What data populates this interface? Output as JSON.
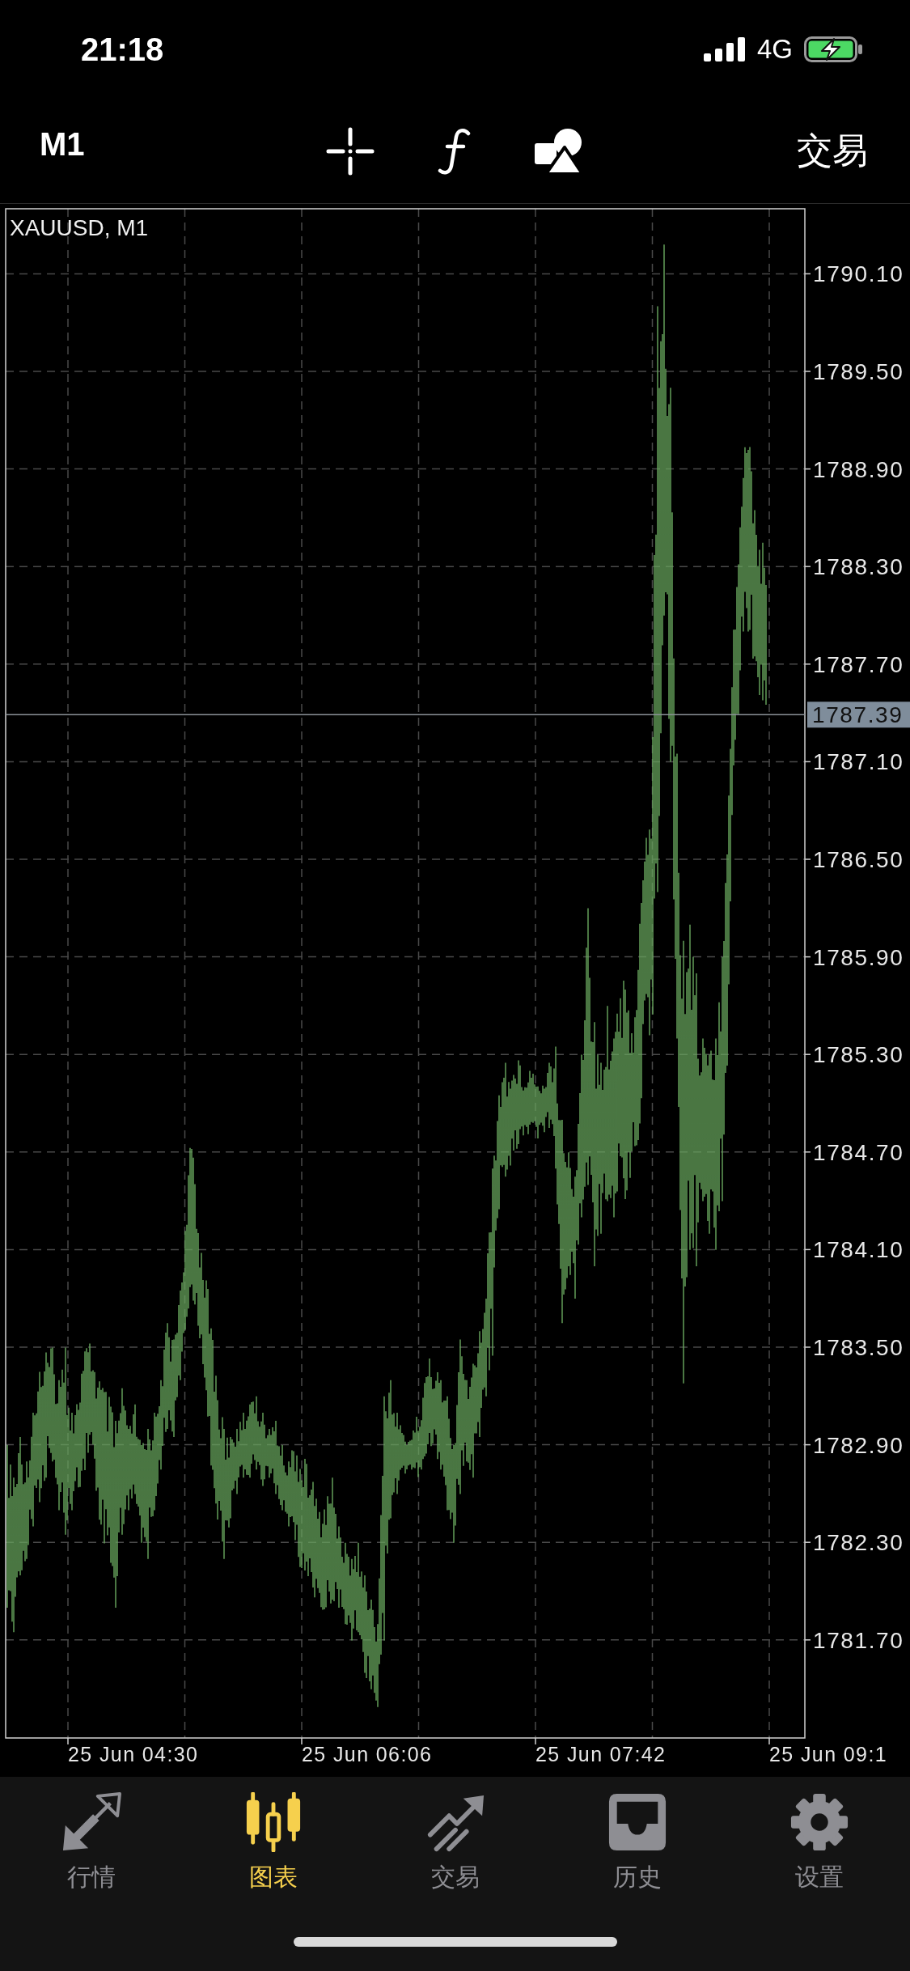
{
  "status_bar": {
    "time": "21:18",
    "network": "4G",
    "battery": {
      "charging": true
    }
  },
  "toolbar": {
    "timeframe": "M1",
    "trade_label": "交易"
  },
  "chart": {
    "title": "XAUUSD, M1",
    "price_labels": [
      "1790.10",
      "1789.50",
      "1788.90",
      "1788.30",
      "1787.70",
      "1787.10",
      "1786.50",
      "1785.90",
      "1785.30",
      "1784.70",
      "1784.10",
      "1783.50",
      "1782.90",
      "1782.30",
      "1781.70"
    ],
    "current_price": "1787.39",
    "time_labels": [
      "25 Jun 04:30",
      "25 Jun 06:06",
      "25 Jun 07:42",
      "25 Jun 09:1"
    ]
  },
  "tab_bar": {
    "tabs": [
      {
        "kind": "quotes",
        "label": "行情",
        "selected": false
      },
      {
        "kind": "chart",
        "label": "图表",
        "selected": true
      },
      {
        "kind": "trade",
        "label": "交易",
        "selected": false
      },
      {
        "kind": "history",
        "label": "历史",
        "selected": false
      },
      {
        "kind": "settings",
        "label": "设置",
        "selected": false
      }
    ]
  }
}
